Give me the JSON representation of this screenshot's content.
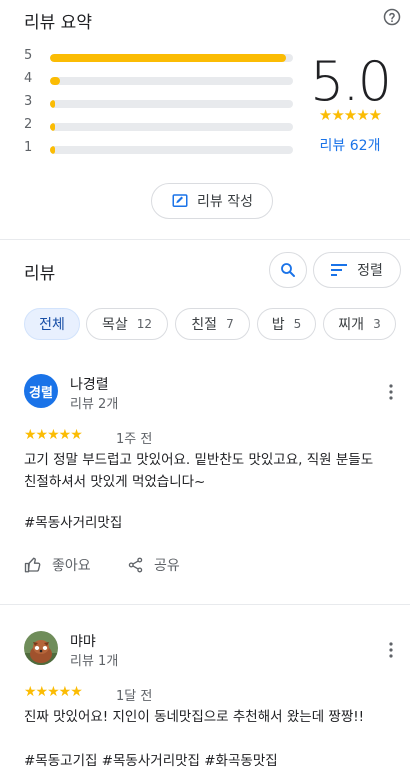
{
  "summary": {
    "title": "리뷰 요약",
    "score": "5.0",
    "stars": "★★★★★",
    "review_count": "리뷰 62개",
    "distribution": [
      {
        "label": "5",
        "fraction": 0.97
      },
      {
        "label": "4",
        "fraction": 0.04
      },
      {
        "label": "3",
        "fraction": 0.01
      },
      {
        "label": "2",
        "fraction": 0.01
      },
      {
        "label": "1",
        "fraction": 0.01
      }
    ],
    "write_review": "리뷰 작성"
  },
  "reviews_header": {
    "title": "리뷰",
    "sort_label": "정렬"
  },
  "chips": [
    {
      "label": "전체",
      "count": ""
    },
    {
      "label": "목살",
      "count": "12"
    },
    {
      "label": "친절",
      "count": "7"
    },
    {
      "label": "밥",
      "count": "5"
    },
    {
      "label": "찌개",
      "count": "3"
    }
  ],
  "reviews": [
    {
      "avatar_text": "경렬",
      "avatar_color": "#1a73e8",
      "name": "나경렬",
      "sub": "리뷰 2개",
      "stars": "★★★★★",
      "when": "1주 전",
      "text": "고기 정말 부드럽고 맛있어요. 밑반찬도 맛있고요, 직원 분들도 친절하셔서 맛있게 먹었습니다~",
      "tags": "#목동사거리맛집",
      "like_label": "좋아요",
      "share_label": "공유"
    },
    {
      "avatar_text": "",
      "avatar_color": "#8d5b3a",
      "name": "먀먀",
      "sub": "리뷰 1개",
      "stars": "★★★★★",
      "when": "1달 전",
      "text": "진짜 맛있어요! 지인이 동네맛집으로 추천해서 왔는데 짱짱!!",
      "tags": "#목동고기집 #목동사거리맛집 #화곡동맛집"
    }
  ],
  "colors": {
    "star": "#fbbc04",
    "accent": "#1a73e8"
  }
}
